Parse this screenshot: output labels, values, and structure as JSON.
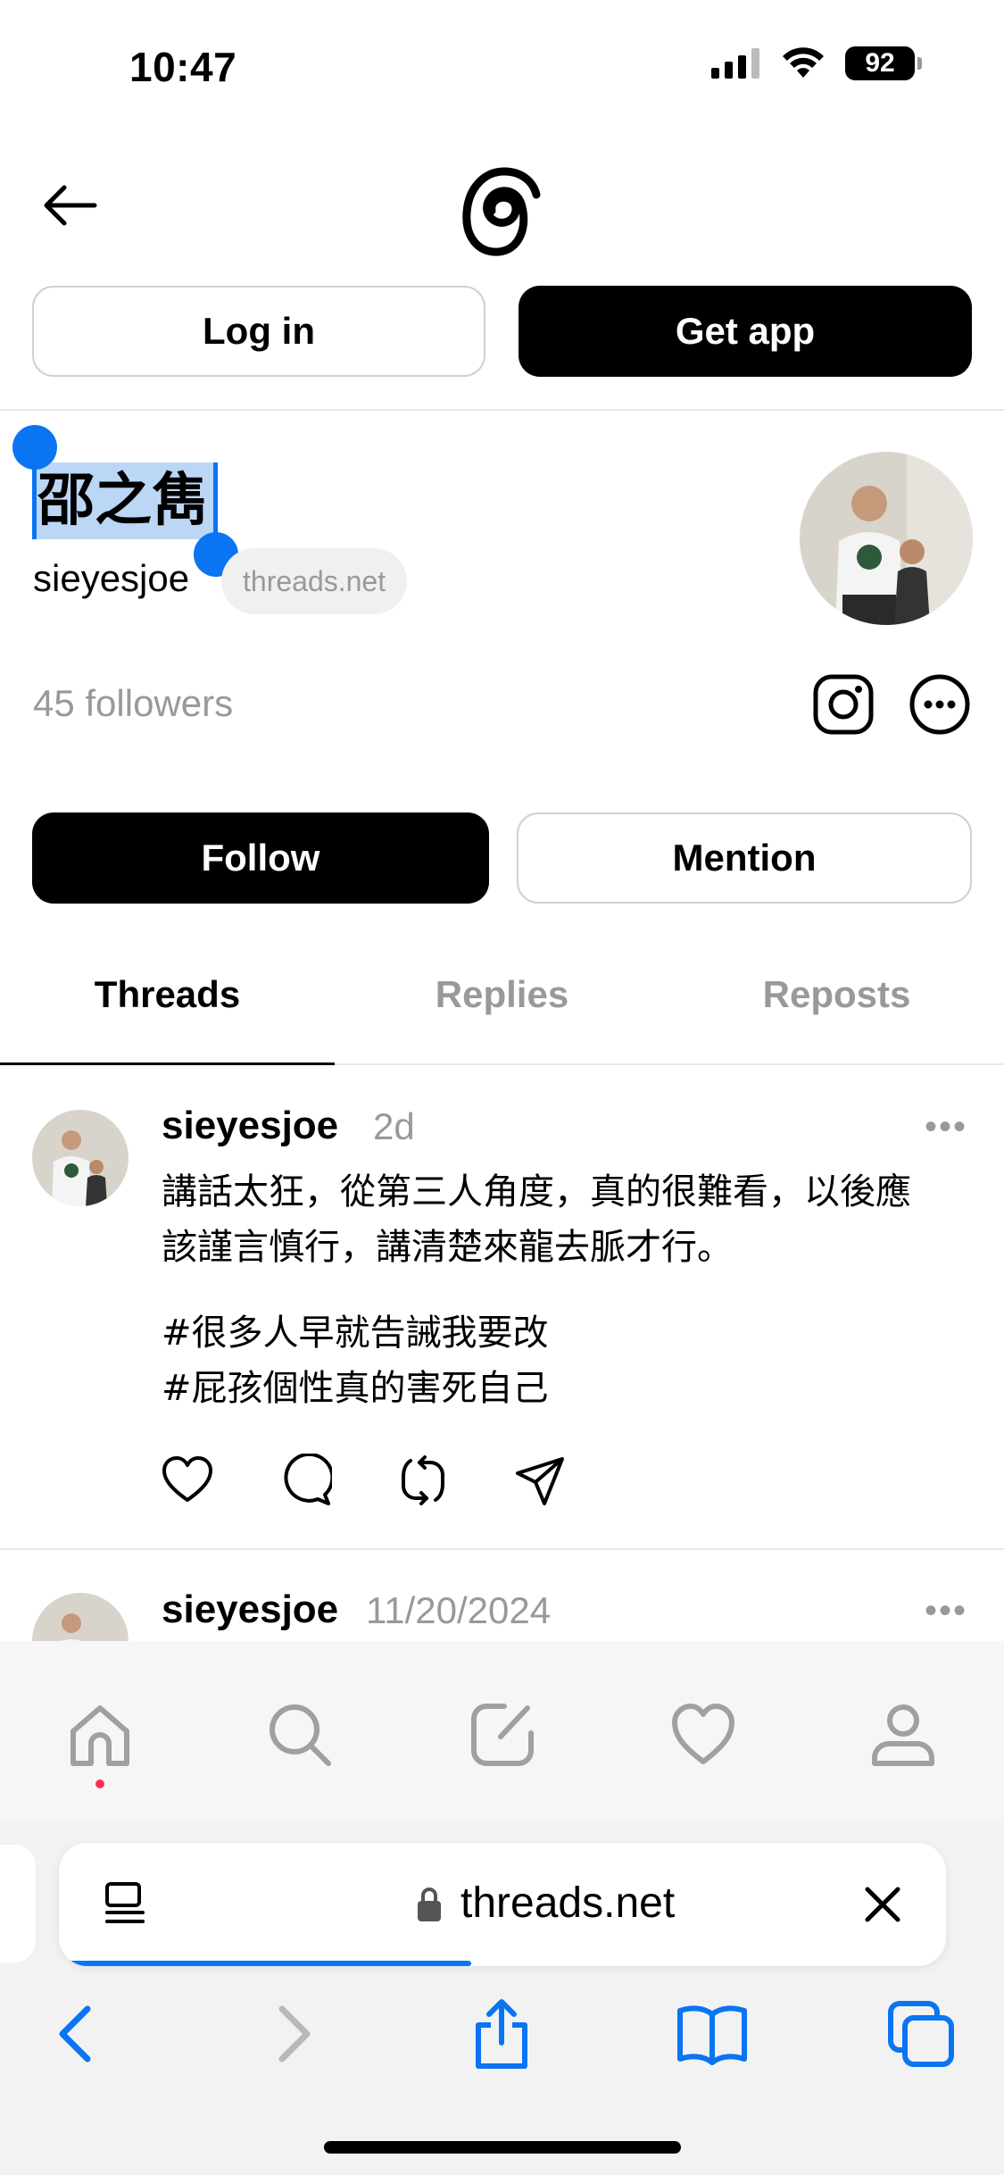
{
  "status_bar": {
    "time": "10:47",
    "battery": "92",
    "icons": [
      "cellular-signal-icon",
      "wifi-icon",
      "battery-icon"
    ]
  },
  "header": {
    "back_icon": "arrow-left-icon",
    "logo_icon": "threads-logo-icon",
    "login_label": "Log in",
    "get_app_label": "Get app"
  },
  "profile": {
    "display_name": "邵之雋",
    "username": "sieyesjoe",
    "domain_badge": "threads.net",
    "followers": "45 followers",
    "follow_label": "Follow",
    "mention_label": "Mention",
    "icons": [
      "instagram-icon",
      "more-options-icon"
    ]
  },
  "tabs": [
    {
      "label": "Threads",
      "active": true
    },
    {
      "label": "Replies",
      "active": false
    },
    {
      "label": "Reposts",
      "active": false
    }
  ],
  "posts": [
    {
      "username": "sieyesjoe",
      "time": "2d",
      "text_line1": "講話太狂，從第三人角度，真的很難看，以後應",
      "text_line2": "該謹言慎行，講清楚來龍去脈才行。",
      "hashtag1": "#很多人早就告誡我要改",
      "hashtag2": "#屁孩個性真的害死自己",
      "actions": [
        "heart-icon",
        "comment-icon",
        "repost-icon",
        "share-icon"
      ]
    },
    {
      "username": "sieyesjoe",
      "time": "11/20/2024"
    }
  ],
  "bottom_nav": [
    "home-icon",
    "search-icon",
    "compose-icon",
    "activity-heart-icon",
    "profile-icon"
  ],
  "safari": {
    "url": "threads.net",
    "toolbar": [
      "back-icon",
      "forward-icon",
      "share-icon",
      "bookmarks-icon",
      "tabs-icon"
    ]
  },
  "colors": {
    "accent": "#0a74f3",
    "selection": "#bcd6f5",
    "muted": "#999999",
    "notification_dot": "#ff2d55"
  }
}
